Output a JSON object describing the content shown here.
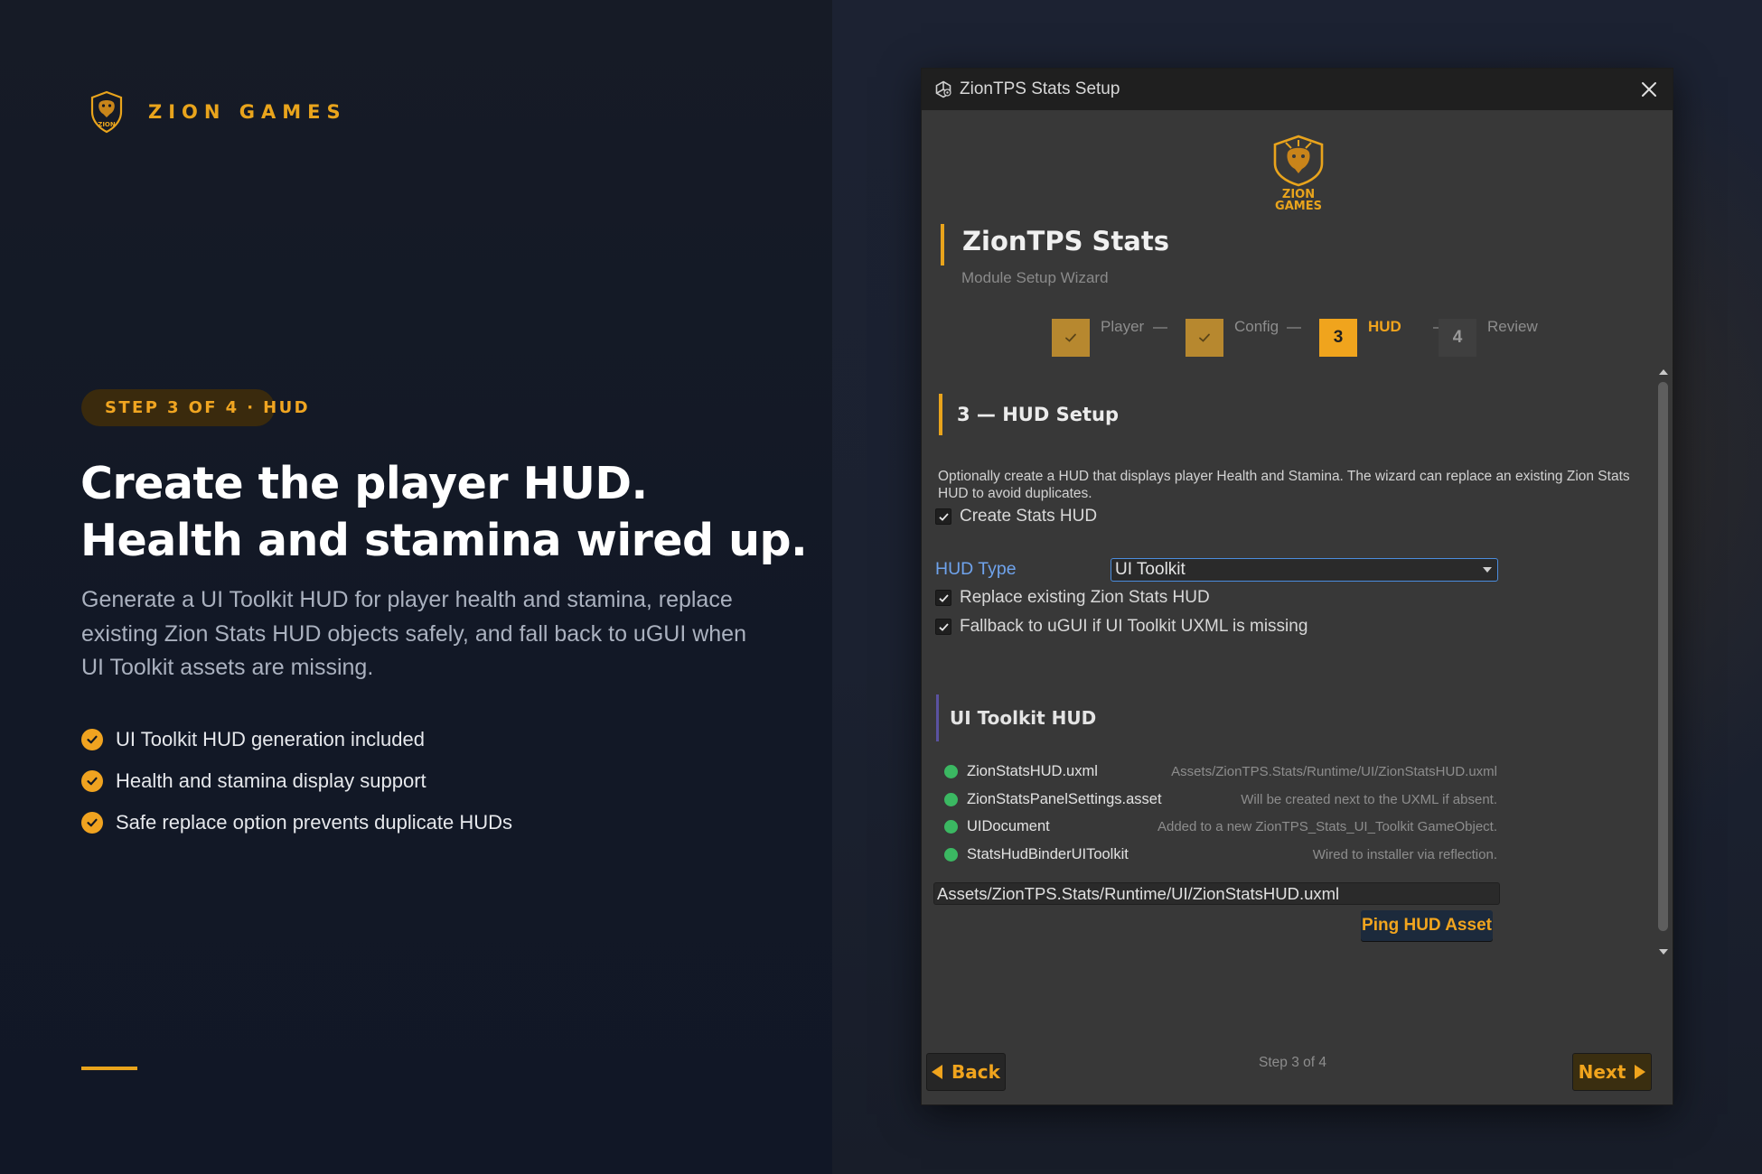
{
  "brand": {
    "name": "ZION GAMES",
    "logo_text": "ZION GAMES"
  },
  "hero": {
    "pill": "STEP 3 OF 4 · HUD",
    "headline_line1": "Create the player HUD.",
    "headline_line2": "Health and stamina wired up.",
    "description": "Generate a UI Toolkit HUD for player health and stamina, replace existing Zion Stats HUD objects safely, and fall back to uGUI when UI Toolkit assets are missing.",
    "features": [
      "UI Toolkit HUD generation included",
      "Health and stamina display support",
      "Safe replace option prevents duplicate HUDs"
    ]
  },
  "window": {
    "title": "ZionTPS Stats Setup",
    "logo_text": "ZION GAMES",
    "wizard_title": "ZionTPS Stats",
    "wizard_subtitle": "Module Setup Wizard",
    "steps": [
      {
        "label": "Player",
        "state": "done"
      },
      {
        "label": "Config",
        "state": "done"
      },
      {
        "number": "3",
        "label": "HUD",
        "state": "active"
      },
      {
        "number": "4",
        "label": "Review",
        "state": "pending"
      }
    ],
    "section_title": "3 — HUD Setup",
    "intro": "Optionally create a HUD that displays player Health and Stamina. The wizard can replace an existing Zion Stats HUD to avoid duplicates.",
    "create_hud_label": "Create Stats HUD",
    "create_hud_checked": true,
    "hud_type_label": "HUD Type",
    "hud_type_value": "UI Toolkit",
    "replace_label": "Replace existing Zion Stats HUD",
    "replace_checked": true,
    "fallback_label": "Fallback to uGUI if UI Toolkit UXML is missing",
    "fallback_checked": true,
    "subsection_title": "UI Toolkit HUD",
    "assets": [
      {
        "name": "ZionStatsHUD.uxml",
        "desc": "Assets/ZionTPS.Stats/Runtime/UI/ZionStatsHUD.uxml",
        "status": "ok"
      },
      {
        "name": "ZionStatsPanelSettings.asset",
        "desc": "Will be created next to the UXML if absent.",
        "status": "ok"
      },
      {
        "name": "UIDocument",
        "desc": "Added to a new ZionTPS_Stats_UI_Toolkit GameObject.",
        "status": "ok"
      },
      {
        "name": "StatsHudBinderUIToolkit",
        "desc": "Wired to installer via reflection.",
        "status": "ok"
      }
    ],
    "asset_path": "Assets/ZionTPS.Stats/Runtime/UI/ZionStatsHUD.uxml",
    "ping_button": "Ping HUD Asset",
    "footer_step": "Step 3 of 4",
    "back_button": "Back",
    "next_button": "Next"
  },
  "colors": {
    "accent": "#e9a41c",
    "link_blue": "#6fa3ec",
    "status_green": "#3bb862",
    "window_bg": "#383838",
    "page_bg": "#121722"
  }
}
